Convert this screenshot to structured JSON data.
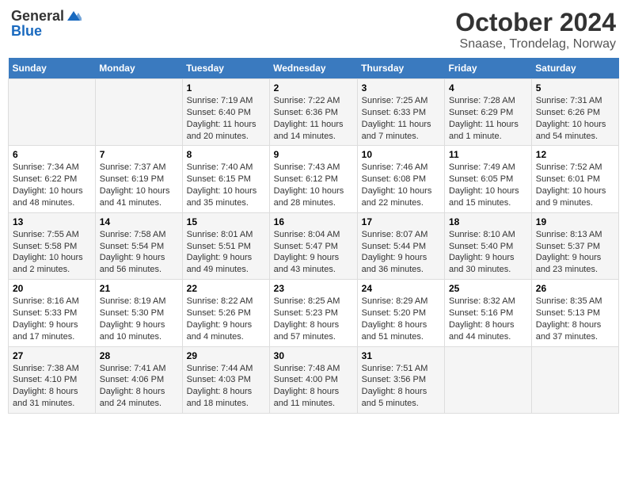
{
  "header": {
    "logo_general": "General",
    "logo_blue": "Blue",
    "title": "October 2024",
    "subtitle": "Snaase, Trondelag, Norway"
  },
  "days_of_week": [
    "Sunday",
    "Monday",
    "Tuesday",
    "Wednesday",
    "Thursday",
    "Friday",
    "Saturday"
  ],
  "weeks": [
    [
      {
        "day": "",
        "info": ""
      },
      {
        "day": "",
        "info": ""
      },
      {
        "day": "1",
        "info": "Sunrise: 7:19 AM\nSunset: 6:40 PM\nDaylight: 11 hours and 20 minutes."
      },
      {
        "day": "2",
        "info": "Sunrise: 7:22 AM\nSunset: 6:36 PM\nDaylight: 11 hours and 14 minutes."
      },
      {
        "day": "3",
        "info": "Sunrise: 7:25 AM\nSunset: 6:33 PM\nDaylight: 11 hours and 7 minutes."
      },
      {
        "day": "4",
        "info": "Sunrise: 7:28 AM\nSunset: 6:29 PM\nDaylight: 11 hours and 1 minute."
      },
      {
        "day": "5",
        "info": "Sunrise: 7:31 AM\nSunset: 6:26 PM\nDaylight: 10 hours and 54 minutes."
      }
    ],
    [
      {
        "day": "6",
        "info": "Sunrise: 7:34 AM\nSunset: 6:22 PM\nDaylight: 10 hours and 48 minutes."
      },
      {
        "day": "7",
        "info": "Sunrise: 7:37 AM\nSunset: 6:19 PM\nDaylight: 10 hours and 41 minutes."
      },
      {
        "day": "8",
        "info": "Sunrise: 7:40 AM\nSunset: 6:15 PM\nDaylight: 10 hours and 35 minutes."
      },
      {
        "day": "9",
        "info": "Sunrise: 7:43 AM\nSunset: 6:12 PM\nDaylight: 10 hours and 28 minutes."
      },
      {
        "day": "10",
        "info": "Sunrise: 7:46 AM\nSunset: 6:08 PM\nDaylight: 10 hours and 22 minutes."
      },
      {
        "day": "11",
        "info": "Sunrise: 7:49 AM\nSunset: 6:05 PM\nDaylight: 10 hours and 15 minutes."
      },
      {
        "day": "12",
        "info": "Sunrise: 7:52 AM\nSunset: 6:01 PM\nDaylight: 10 hours and 9 minutes."
      }
    ],
    [
      {
        "day": "13",
        "info": "Sunrise: 7:55 AM\nSunset: 5:58 PM\nDaylight: 10 hours and 2 minutes."
      },
      {
        "day": "14",
        "info": "Sunrise: 7:58 AM\nSunset: 5:54 PM\nDaylight: 9 hours and 56 minutes."
      },
      {
        "day": "15",
        "info": "Sunrise: 8:01 AM\nSunset: 5:51 PM\nDaylight: 9 hours and 49 minutes."
      },
      {
        "day": "16",
        "info": "Sunrise: 8:04 AM\nSunset: 5:47 PM\nDaylight: 9 hours and 43 minutes."
      },
      {
        "day": "17",
        "info": "Sunrise: 8:07 AM\nSunset: 5:44 PM\nDaylight: 9 hours and 36 minutes."
      },
      {
        "day": "18",
        "info": "Sunrise: 8:10 AM\nSunset: 5:40 PM\nDaylight: 9 hours and 30 minutes."
      },
      {
        "day": "19",
        "info": "Sunrise: 8:13 AM\nSunset: 5:37 PM\nDaylight: 9 hours and 23 minutes."
      }
    ],
    [
      {
        "day": "20",
        "info": "Sunrise: 8:16 AM\nSunset: 5:33 PM\nDaylight: 9 hours and 17 minutes."
      },
      {
        "day": "21",
        "info": "Sunrise: 8:19 AM\nSunset: 5:30 PM\nDaylight: 9 hours and 10 minutes."
      },
      {
        "day": "22",
        "info": "Sunrise: 8:22 AM\nSunset: 5:26 PM\nDaylight: 9 hours and 4 minutes."
      },
      {
        "day": "23",
        "info": "Sunrise: 8:25 AM\nSunset: 5:23 PM\nDaylight: 8 hours and 57 minutes."
      },
      {
        "day": "24",
        "info": "Sunrise: 8:29 AM\nSunset: 5:20 PM\nDaylight: 8 hours and 51 minutes."
      },
      {
        "day": "25",
        "info": "Sunrise: 8:32 AM\nSunset: 5:16 PM\nDaylight: 8 hours and 44 minutes."
      },
      {
        "day": "26",
        "info": "Sunrise: 8:35 AM\nSunset: 5:13 PM\nDaylight: 8 hours and 37 minutes."
      }
    ],
    [
      {
        "day": "27",
        "info": "Sunrise: 7:38 AM\nSunset: 4:10 PM\nDaylight: 8 hours and 31 minutes."
      },
      {
        "day": "28",
        "info": "Sunrise: 7:41 AM\nSunset: 4:06 PM\nDaylight: 8 hours and 24 minutes."
      },
      {
        "day": "29",
        "info": "Sunrise: 7:44 AM\nSunset: 4:03 PM\nDaylight: 8 hours and 18 minutes."
      },
      {
        "day": "30",
        "info": "Sunrise: 7:48 AM\nSunset: 4:00 PM\nDaylight: 8 hours and 11 minutes."
      },
      {
        "day": "31",
        "info": "Sunrise: 7:51 AM\nSunset: 3:56 PM\nDaylight: 8 hours and 5 minutes."
      },
      {
        "day": "",
        "info": ""
      },
      {
        "day": "",
        "info": ""
      }
    ]
  ]
}
